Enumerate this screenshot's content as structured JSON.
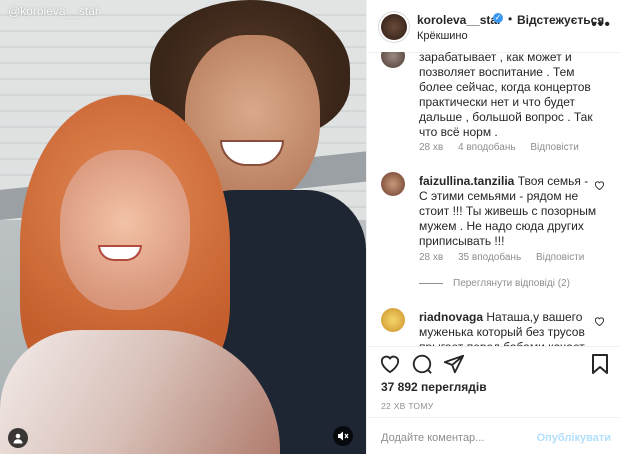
{
  "media": {
    "watermark": "@koroleva__star"
  },
  "header": {
    "username": "koroleva__star",
    "separator": "•",
    "follow_label": "Відстежується",
    "location": "Крёкшино",
    "more_icon": "more-icon"
  },
  "comments": [
    {
      "username": "",
      "text": "зарабатывает , как может и позволяет воспитание . Тем более сейчас, когда концертов практически нет и что будет дальше , большой вопрос . Так что всё норм .",
      "time": "28 хв",
      "likes": "4 вподобань",
      "reply": "Відповісти"
    },
    {
      "username": "faizullina.tanzilia",
      "text": "Твоя семья - С этими семьями - рядом не стоит !!! Ты живешь с позорным мужем . Не надо сюда других приписывать !!!",
      "time": "28 хв",
      "likes": "35 вподобань",
      "reply": "Відповісти",
      "view_replies": "Переглянути відповіді (2)"
    },
    {
      "username": "riadnovaga",
      "text": "Наташа,у вашего муженька который без трусов прыгает перед бабами качает ...",
      "time": "",
      "likes": "",
      "reply": ""
    }
  ],
  "stats": {
    "views": "37 892 переглядів",
    "time_ago": "22 ХВ ТОМУ"
  },
  "add_comment": {
    "placeholder": "Додайте коментар...",
    "post_label": "Опублікувати"
  },
  "colors": {
    "verified": "#3897f0",
    "post_disabled": "#b2dffc"
  }
}
